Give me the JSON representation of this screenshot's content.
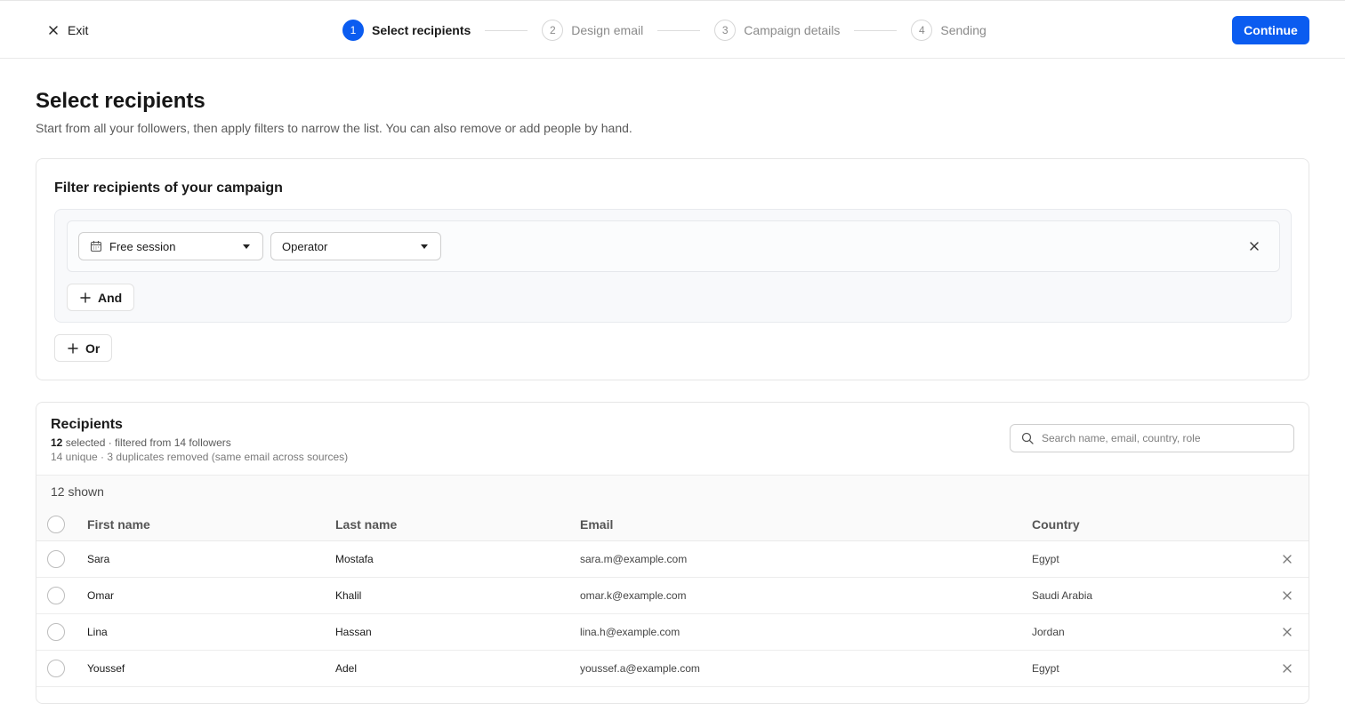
{
  "topbar": {
    "exit_label": "Exit",
    "continue_label": "Continue",
    "steps": [
      {
        "num": "1",
        "label": "Select recipients",
        "active": true
      },
      {
        "num": "2",
        "label": "Design email",
        "active": false
      },
      {
        "num": "3",
        "label": "Campaign details",
        "active": false
      },
      {
        "num": "4",
        "label": "Sending",
        "active": false
      }
    ]
  },
  "page": {
    "title": "Select recipients",
    "subtitle": "Start from all your followers, then apply filters to narrow the list. You can also remove or add people by hand."
  },
  "filter": {
    "title": "Filter recipients of your campaign",
    "field_select": "Free session",
    "operator_select": "Operator",
    "and_label": "And",
    "or_label": "Or"
  },
  "recipients": {
    "title": "Recipients",
    "selected_count": "12",
    "selected_suffix": " selected · filtered from 14 followers",
    "summary": "14 unique · 3 duplicates removed (same email across sources)",
    "search_placeholder": "Search name, email, country, role",
    "shown_label": "12 shown",
    "columns": [
      "First name",
      "Last name",
      "Email",
      "Country"
    ],
    "rows": [
      {
        "first": "Sara",
        "last": "Mostafa",
        "email": "sara.m@example.com",
        "country": "Egypt"
      },
      {
        "first": "Omar",
        "last": "Khalil",
        "email": "omar.k@example.com",
        "country": "Saudi Arabia"
      },
      {
        "first": "Lina",
        "last": "Hassan",
        "email": "lina.h@example.com",
        "country": "Jordan"
      },
      {
        "first": "Youssef",
        "last": "Adel",
        "email": "youssef.a@example.com",
        "country": "Egypt"
      }
    ]
  },
  "colors": {
    "accent": "#0b5cf0",
    "border": "#e6e6e6",
    "muted_text": "#5b5b5b"
  },
  "icons": {
    "exit": "close-icon",
    "calendar": "calendar-icon",
    "remove": "close-icon",
    "add": "plus-icon",
    "search": "search-icon",
    "caret": "chevron-down-icon"
  }
}
